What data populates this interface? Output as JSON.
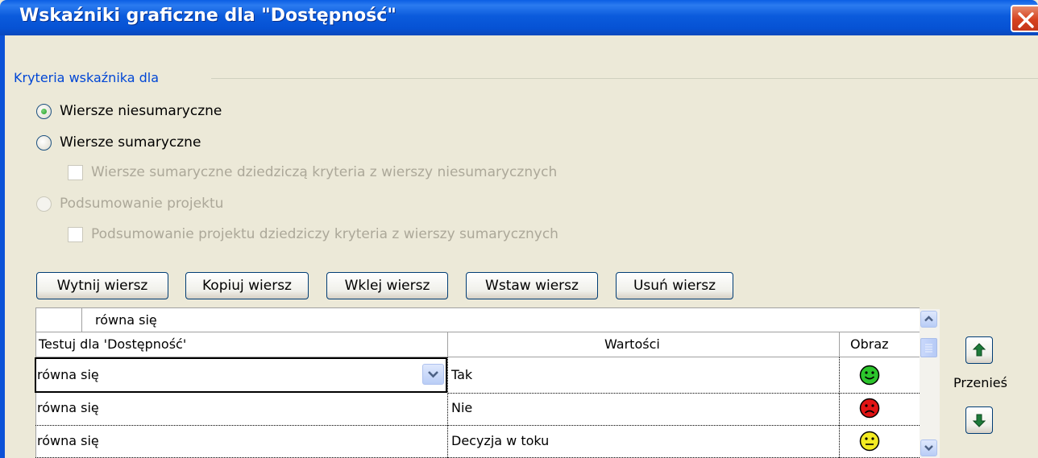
{
  "window": {
    "title": "Wskaźniki graficzne dla \"Dostępność\""
  },
  "criteria": {
    "group_label": "Kryteria wskaźnika dla",
    "options": [
      {
        "label": "Wiersze niesumaryczne",
        "selected": true,
        "enabled": true
      },
      {
        "label": "Wiersze sumaryczne",
        "selected": false,
        "enabled": true
      },
      {
        "label": "Podsumowanie projektu",
        "selected": false,
        "enabled": false
      }
    ],
    "checkboxes": [
      {
        "label": "Wiersze sumaryczne dziedziczą kryteria z wierszy niesumarycznych",
        "checked": false,
        "enabled": false
      },
      {
        "label": "Podsumowanie projektu dziedziczy kryteria z wierszy sumarycznych",
        "checked": false,
        "enabled": false
      }
    ]
  },
  "toolbar": {
    "cut": "Wytnij wiersz",
    "copy": "Kopiuj wiersz",
    "paste": "Wklej wiersz",
    "insert": "Wstaw wiersz",
    "delete": "Usuń wiersz"
  },
  "grid": {
    "edit_value": "równa się",
    "headers": [
      "Testuj dla 'Dostępność'",
      "Wartości",
      "Obraz"
    ],
    "rows": [
      {
        "test": "równa się",
        "value": "Tak",
        "image": "green-smiley-icon",
        "color": "#22c322"
      },
      {
        "test": "równa się",
        "value": "Nie",
        "image": "red-sad-face-icon",
        "color": "#e01414"
      },
      {
        "test": "równa się",
        "value": "Decyzja w toku",
        "image": "yellow-neutral-face-icon",
        "color": "#f2ea22"
      }
    ]
  },
  "move": {
    "label": "Przenieś"
  }
}
